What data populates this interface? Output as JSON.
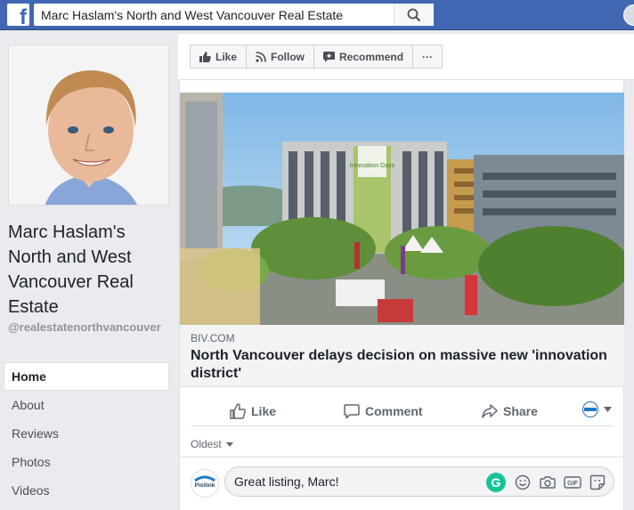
{
  "topbar": {
    "logo_letter": "f",
    "search_value": "Marc Haslam's North and West Vancouver Real Estate"
  },
  "profile": {
    "name": "Marc Haslam's North and West Vancouver Real Estate",
    "handle": "@realestatenorthvancouver"
  },
  "nav": {
    "items": [
      {
        "label": "Home"
      },
      {
        "label": "About"
      },
      {
        "label": "Reviews"
      },
      {
        "label": "Photos"
      },
      {
        "label": "Videos"
      }
    ]
  },
  "actionbar": {
    "like_label": "Like",
    "follow_label": "Follow",
    "recommend_label": "Recommend",
    "more_label": "···"
  },
  "post": {
    "image_caption": "Innovation Days",
    "link_domain": "BIV.COM",
    "link_title": "North Vancouver delays decision on massive new 'innovation district'",
    "actions": {
      "like_label": "Like",
      "comment_label": "Comment",
      "share_label": "Share"
    },
    "sort_label": "Oldest",
    "comment": {
      "value": "Great listing, Marc!",
      "avatar_text": "Pixilink",
      "grammarly_letter": "G",
      "gif_label": "GIF"
    }
  },
  "colors": {
    "brand": "#4267b2",
    "page_bg": "#e9ebee",
    "grammarly": "#15c39a"
  }
}
